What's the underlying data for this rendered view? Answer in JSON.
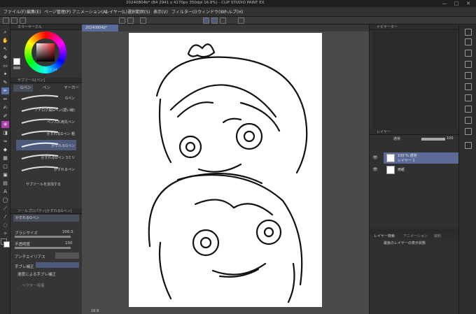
{
  "title": {
    "text": "20240804b* (B4 2941 x 4170px 350dpi 16.8%) - CLIP STUDIO PAINT EX",
    "minimize": "—",
    "maximize": "□",
    "close": "✕"
  },
  "menu": [
    "ファイル(F)",
    "編集(E)",
    "ページ管理(P)",
    "アニメーション(A)",
    "レイヤー(L)",
    "選択範囲(S)",
    "表示(V)",
    "フィルター(I)",
    "ウィンドウ(W)",
    "ヘルプ(H)"
  ],
  "document": {
    "tab": "20240804b*"
  },
  "color_panel": {
    "header": "カラーサークル",
    "main_color": "#f21f2c",
    "sub_color": "#ffffff",
    "readout": "S 100 V 24"
  },
  "subtool": {
    "header": "サブツール[ペン]",
    "tabs": [
      "Gペン",
      "ペン",
      "マーカー"
    ],
    "brushes": [
      "Gペン",
      "アナログ風Gペン(濃い線)",
      "ペン入れ用丸ペン",
      "かすれるGペン 粗",
      "かすれるGペン",
      "かすれるGペン 3ミリ",
      "かすれるペン"
    ],
    "add": "サブツールを追加する"
  },
  "tool_property": {
    "header": "ツールプロパティ[かすれるGペン]",
    "name": "かすれるGペン",
    "brush_size_label": "ブラシサイズ",
    "brush_size": "200.5",
    "opacity_label": "不透明度",
    "opacity": "100",
    "antialias_label": "アンチエイリアス",
    "stabilization_label": "手ブレ補正",
    "speed_label": "速度による手ブレ補正",
    "vector_label": "ベクター吸着"
  },
  "navigator": {
    "header": "ナビゲーター"
  },
  "layer_panel": {
    "header": "レイヤー",
    "blend": "通常",
    "opacity": "100",
    "layers": [
      {
        "title": "100 % 通常",
        "name": "レイヤー 1"
      },
      {
        "title": "",
        "name": "用紙"
      }
    ]
  },
  "layer_search": {
    "tabs": [
      "レイヤー検索",
      "アニメーション",
      "資料"
    ],
    "filter": "最後のレイヤーの表示状態"
  },
  "status": {
    "zoom": "16.9"
  }
}
